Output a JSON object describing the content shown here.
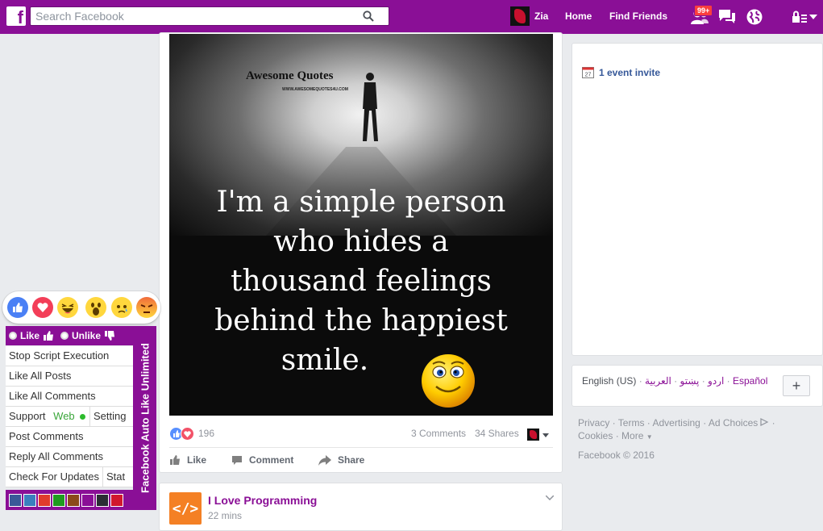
{
  "topbar": {
    "logo_letter": "f",
    "search_placeholder": "Search Facebook",
    "user_name": "Zia",
    "nav": [
      "Home",
      "Find Friends"
    ],
    "friend_requests_badge": "99+",
    "icons": [
      "friends-icon",
      "messages-icon",
      "globe-icon",
      "privacy-lock-icon",
      "menu-caret-icon"
    ]
  },
  "post": {
    "image_brand": "Awesome Quotes",
    "image_brand_url": "WWW.AWESOMEQUOTES4U.COM",
    "quote_lines": [
      "I'm a simple person",
      "who hides a",
      "thousand feelings",
      "behind the happiest",
      "smile."
    ],
    "reaction_count": "196",
    "comments": "3 Comments",
    "shares": "34 Shares",
    "actions": [
      "Like",
      "Comment",
      "Share"
    ]
  },
  "sidebar": {
    "calendar_day": "27",
    "event_invite": "1 event invite"
  },
  "languages": {
    "current": "English (US)",
    "others": [
      "اردو",
      "پښتو",
      "العربية",
      "Español"
    ],
    "add_label": "+"
  },
  "footer": {
    "links": [
      "Privacy",
      "Terms",
      "Advertising",
      "Ad Choices",
      "Cookies",
      "More"
    ],
    "copyright": "Facebook © 2016"
  },
  "auto_like_panel": {
    "reactions": [
      "like-reaction",
      "love-reaction",
      "haha-reaction",
      "wow-reaction",
      "sad-reaction",
      "angry-reaction"
    ],
    "header_like": "Like",
    "header_unlike": "Unlike",
    "items": [
      "Stop Script Execution",
      "Like All Posts",
      "Like All Comments",
      "Post Comments",
      "Reply All Comments"
    ],
    "support_label": "Support",
    "web_label": "Web",
    "setting_label": "Setting",
    "updates_label": "Check For Updates",
    "stat_label": "Stat",
    "side_title": "Facebook Auto Like Unlimited",
    "swatch_colors": [
      "#3b5998",
      "#3b7fbe",
      "#e03b2c",
      "#1f9b1f",
      "#8b4a1a",
      "#8a0f96",
      "#2b2d35",
      "#d1172e"
    ]
  },
  "next_post": {
    "logo_text": "</>",
    "page_name": "I Love Programming",
    "time": "22 mins"
  },
  "colors": {
    "brand_purple": "#8a0f96",
    "link_blue": "#365899",
    "page_bg": "#e9ebee"
  }
}
